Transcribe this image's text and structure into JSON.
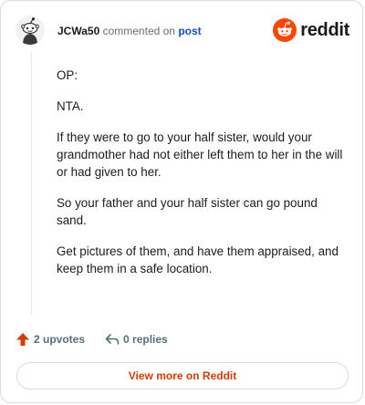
{
  "header": {
    "username": "JCWa50",
    "action_text": "commented on",
    "post_link": "post",
    "brand": "reddit"
  },
  "comment": {
    "paragraphs": [
      "OP:",
      "NTA.",
      "If they were to go to your half sister, would your grandmother had not either left them to her in the will or had given to her.",
      "So your father and your half sister can go pound sand.",
      "Get pictures of them, and have them appraised, and keep them in a safe location."
    ]
  },
  "actions": {
    "upvotes": "2 upvotes",
    "replies": "0 replies"
  },
  "footer": {
    "view_more": "View more on Reddit"
  },
  "colors": {
    "accent": "#d93a00",
    "brand_orange": "#ff4500",
    "link": "#0a4fcf"
  },
  "icons": [
    "avatar-snoo",
    "reddit-logo-icon",
    "upvote-arrow-icon",
    "reply-arrow-icon"
  ]
}
